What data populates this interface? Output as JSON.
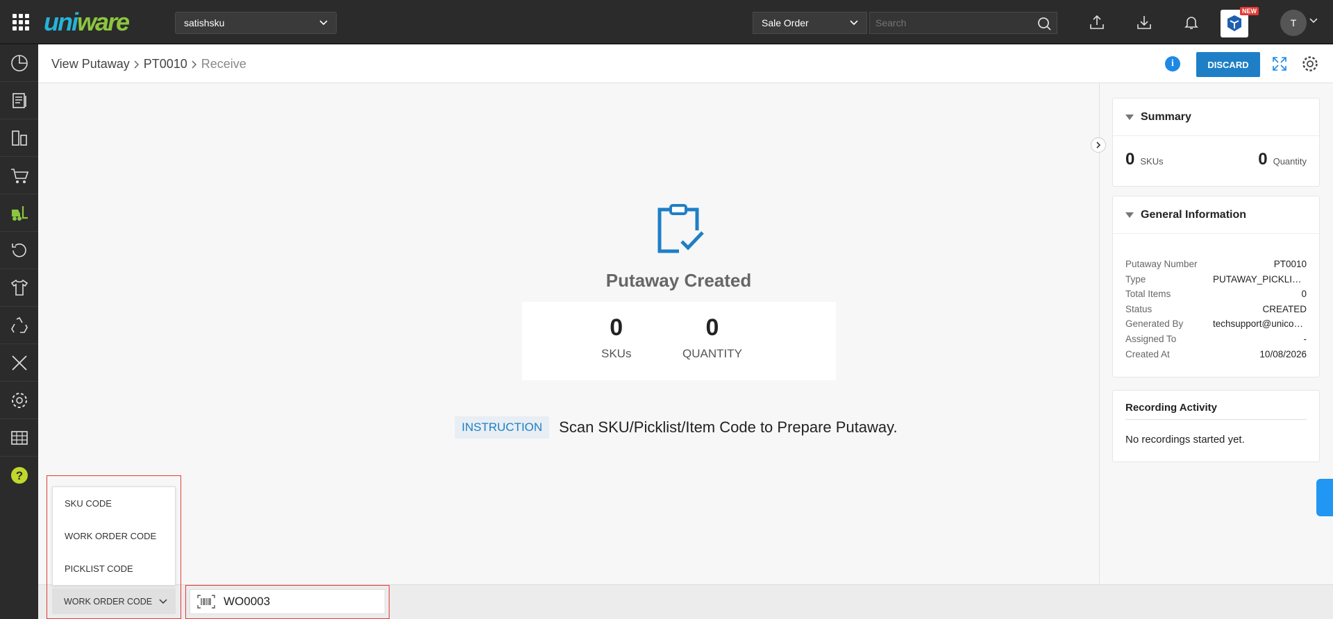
{
  "topbar": {
    "facility": "satishsku",
    "search_type": "Sale Order",
    "search_placeholder": "Search",
    "new_badge": "NEW",
    "avatar_initial": "T",
    "logo_part1": "uni",
    "logo_part2": "ware"
  },
  "header": {
    "breadcrumb": [
      "View Putaway",
      "PT0010",
      "Receive"
    ],
    "discard_label": "DISCARD"
  },
  "main": {
    "title": "Putaway Created",
    "skus_value": "0",
    "skus_label": "SKUs",
    "quantity_value": "0",
    "quantity_label": "QUANTITY",
    "instruction_tag": "INSTRUCTION",
    "instruction_text": "Scan SKU/Picklist/Item Code to Prepare Putaway."
  },
  "summary": {
    "title": "Summary",
    "skus_value": "0",
    "skus_label": "SKUs",
    "quantity_value": "0",
    "quantity_label": "Quantity"
  },
  "general_info": {
    "title": "General Information",
    "rows": [
      {
        "k": "Putaway Number",
        "v": "PT0010"
      },
      {
        "k": "Type",
        "v": "PUTAWAY_PICKLIST_ITEM"
      },
      {
        "k": "Total Items",
        "v": "0"
      },
      {
        "k": "Status",
        "v": "CREATED"
      },
      {
        "k": "Generated By",
        "v": "techsupport@unicommerce.com"
      },
      {
        "k": "Assigned To",
        "v": "-"
      },
      {
        "k": "Created At",
        "v": "10/08/2026"
      }
    ]
  },
  "recording": {
    "title": "Recording Activity",
    "text": "No recordings started yet."
  },
  "bottom": {
    "menu_items": [
      "SKU CODE",
      "WORK ORDER CODE",
      "PICKLIST CODE"
    ],
    "selected_type": "WORK ORDER CODE",
    "scan_value": "WO0003"
  },
  "colors": {
    "accent": "#1e7fc6",
    "topbar": "#2b2b2b",
    "highlight": "#e53935"
  }
}
